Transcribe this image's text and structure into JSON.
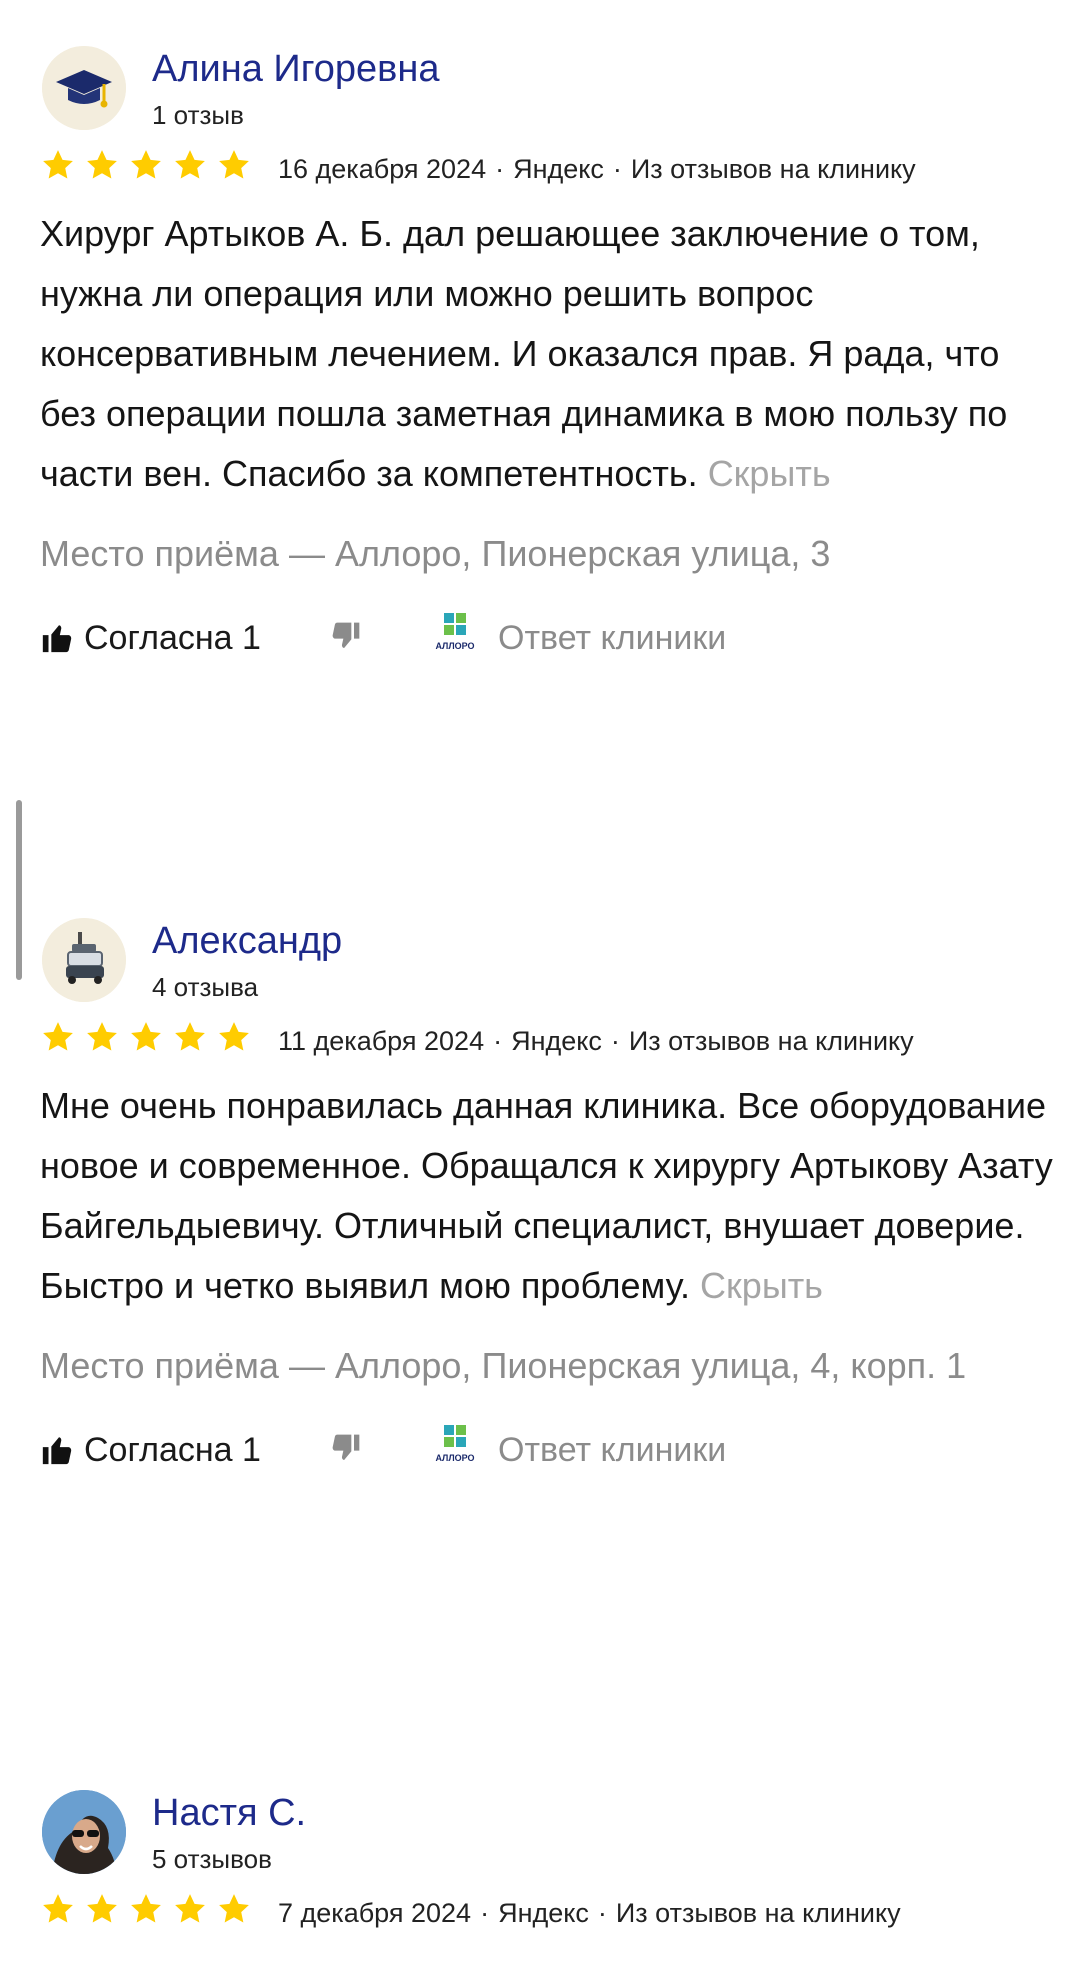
{
  "reviews": [
    {
      "author": "Алина Игоревна",
      "reviews_count": "1 отзыв",
      "rating": 5,
      "date": "16 декабря 2024",
      "source": "Яндекс",
      "context": "Из отзывов на клинику",
      "text": "Хирург Артыков А. Б. дал решающее заключение о том, нужна ли операция или можно решить вопрос консервативным лечением. И оказался прав. Я рада, что без операции пошла заметная динамика в мою пользу по части вен. Спасибо за компетентность.",
      "hide_label": "Скрыть",
      "place": "Место приёма — Аллоро, Пионерская улица, 3",
      "agree_label": "Согласна 1",
      "clinic_reply_label": "Ответ клиники",
      "avatar_icon": "graduation-cap-icon"
    },
    {
      "author": "Александр",
      "reviews_count": "4 отзыва",
      "rating": 5,
      "date": "11 декабря 2024",
      "source": "Яндекс",
      "context": "Из отзывов на клинику",
      "text": "Мне очень понравилась данная клиника. Все оборудование новое и современное. Обращался к хирургу Артыкову Азату Байгельдыевичу. Отличный специалист, внушает доверие. Быстро и четко выявил мою проблему.",
      "hide_label": "Скрыть",
      "place": "Место приёма — Аллоро, Пионерская улица, 4, корп. 1",
      "agree_label": "Согласна 1",
      "clinic_reply_label": "Ответ клиники",
      "avatar_icon": "robot-icon"
    },
    {
      "author": "Настя С.",
      "reviews_count": "5 отзывов",
      "rating": 5,
      "date": "7 декабря 2024",
      "source": "Яндекс",
      "context": "Из отзывов на клинику",
      "avatar_icon": "user-photo"
    }
  ],
  "clinic_logo_text": "АЛЛОРО",
  "colors": {
    "author_name": "#1d2a8a",
    "star": "#ffcc00",
    "muted": "#8b8b8b",
    "hide_link": "#a5a5a5"
  }
}
